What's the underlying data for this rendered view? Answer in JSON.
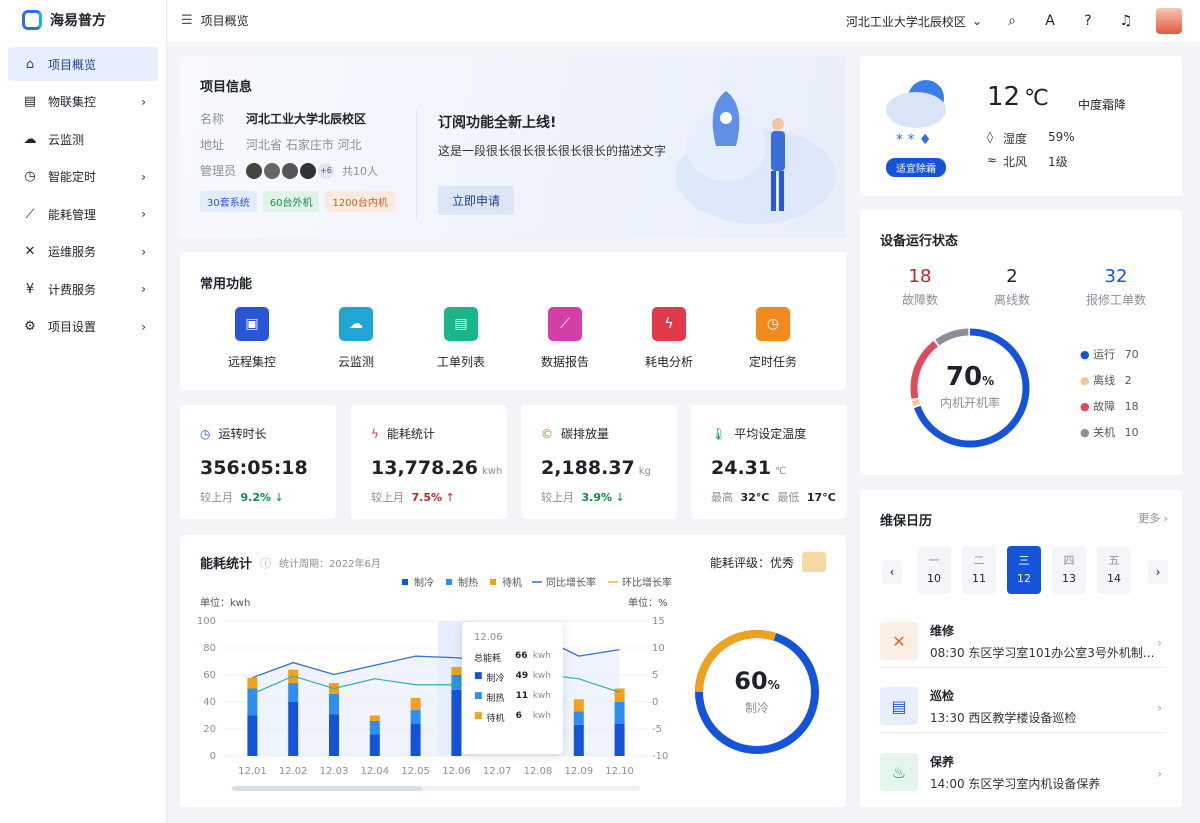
{
  "brand": "海易普方",
  "sidebar": {
    "items": [
      {
        "label": "项目概览",
        "icon": "home-icon",
        "active": true,
        "has_children": false
      },
      {
        "label": "物联集控",
        "icon": "iot-icon",
        "active": false,
        "has_children": true
      },
      {
        "label": "云监测",
        "icon": "cloud-icon",
        "active": false,
        "has_children": false
      },
      {
        "label": "智能定时",
        "icon": "clock-icon",
        "active": false,
        "has_children": true
      },
      {
        "label": "能耗管理",
        "icon": "chart-icon",
        "active": false,
        "has_children": true
      },
      {
        "label": "运维服务",
        "icon": "tools-icon",
        "active": false,
        "has_children": true
      },
      {
        "label": "计费服务",
        "icon": "billing-icon",
        "active": false,
        "has_children": true
      },
      {
        "label": "项目设置",
        "icon": "gear-icon",
        "active": false,
        "has_children": true
      }
    ]
  },
  "header": {
    "breadcrumb": "项目概览",
    "campus": "河北工业大学北辰校区"
  },
  "project": {
    "title": "项目信息",
    "name_label": "名称",
    "name": "河北工业大学北辰校区",
    "addr_label": "地址",
    "addr": "河北省 石家庄市 河北",
    "admin_label": "管理员",
    "admin_more": "+6",
    "admin_total": "共10人",
    "tags": [
      "30套系统",
      "60台外机",
      "1200台内机"
    ],
    "promo_title": "订阅功能全新上线!",
    "promo_desc": "这是一段很长很长很长很长很长的描述文字",
    "promo_btn": "立即申请"
  },
  "functions": {
    "title": "常用功能",
    "items": [
      {
        "label": "远程集控",
        "color": "#2857d6"
      },
      {
        "label": "云监测",
        "color": "#20a5d6"
      },
      {
        "label": "工单列表",
        "color": "#1bb58a"
      },
      {
        "label": "数据报告",
        "color": "#d33fa6"
      },
      {
        "label": "耗电分析",
        "color": "#e03a4a"
      },
      {
        "label": "定时任务",
        "color": "#f08a1c"
      }
    ]
  },
  "stats": [
    {
      "label": "运转时长",
      "value": "356:05:18",
      "unit": "",
      "cmp_label": "较上月",
      "cmp": "9.2%",
      "dir": "↓",
      "color": "#0c8a4a"
    },
    {
      "label": "能耗统计",
      "value": "13,778.26",
      "unit": "kwh",
      "cmp_label": "较上月",
      "cmp": "7.5%",
      "dir": "↑",
      "color": "#c8202a"
    },
    {
      "label": "碳排放量",
      "value": "2,188.37",
      "unit": "kg",
      "cmp_label": "较上月",
      "cmp": "3.9%",
      "dir": "↓",
      "color": "#0c8a4a"
    },
    {
      "label": "平均设定温度",
      "value": "24.31",
      "unit": "℃",
      "max_label": "最高",
      "max": "32°C",
      "min_label": "最低",
      "min": "17°C"
    }
  ],
  "energy": {
    "title": "能耗统计",
    "period": "统计周期：2022年6月",
    "rating": "能耗评级：优秀",
    "legend": [
      "制冷",
      "制热",
      "待机",
      "同比增长率",
      "环比增长率"
    ],
    "unit_left": "单位：kwh",
    "unit_right": "单位：%",
    "tooltip": {
      "date": "12.06",
      "total_label": "总能耗",
      "total": "66",
      "unit": "kwh",
      "rows": [
        {
          "label": "制冷",
          "value": "49"
        },
        {
          "label": "制热",
          "value": "11"
        },
        {
          "label": "待机",
          "value": "6"
        }
      ]
    },
    "donut_value": "60",
    "donut_pct": "%",
    "donut_label": "制冷",
    "colors": {
      "cool": "#1554d9",
      "heat": "#2f8ff0",
      "standby": "#f0a21c",
      "yoy": "#2f6fd6",
      "mom": "#f0b63c"
    }
  },
  "chart_data": {
    "type": "bar",
    "categories": [
      "12.01",
      "12.02",
      "12.03",
      "12.04",
      "12.05",
      "12.06",
      "12.07",
      "12.08",
      "12.09",
      "12.10"
    ],
    "series": [
      {
        "name": "制冷",
        "values": [
          30,
          40,
          31,
          16,
          24,
          49,
          0,
          0,
          23,
          24
        ]
      },
      {
        "name": "制热",
        "values": [
          20,
          14,
          15,
          10,
          10,
          11,
          0,
          0,
          10,
          16
        ]
      },
      {
        "name": "待机",
        "values": [
          8,
          10,
          8,
          4,
          9,
          6,
          0,
          0,
          9,
          10
        ]
      },
      {
        "name": "同比增长率",
        "values": [
          4.5,
          7.3,
          5.1,
          6.8,
          8.5,
          8.2,
          7.6,
          12.2,
          8.5,
          9.7
        ]
      },
      {
        "name": "环比增长率",
        "values": [
          1.5,
          4.8,
          2.5,
          4.3,
          3.2,
          3.2,
          3.3,
          5.2,
          4.3,
          1.8
        ]
      }
    ],
    "ylim": [
      0,
      100
    ],
    "y2lim": [
      -10,
      15
    ],
    "yticks": [
      0,
      20,
      40,
      60,
      80,
      100
    ],
    "y2ticks": [
      -10,
      -5,
      0,
      5,
      10,
      15
    ]
  },
  "weather": {
    "temp": "12",
    "unit": "℃",
    "condition": "中度霜降",
    "humidity_label": "湿度",
    "humidity": "59%",
    "wind_label": "北风",
    "wind": "1级",
    "badge": "适宜除霜"
  },
  "device": {
    "title": "设备运行状态",
    "fault": "18",
    "fault_label": "故障数",
    "offline": "2",
    "offline_label": "离线数",
    "repair": "32",
    "repair_label": "报修工单数",
    "rate": "70",
    "rate_pct": "%",
    "rate_label": "内机开机率",
    "legend": [
      {
        "label": "运行",
        "value": "70",
        "color": "#1554d9"
      },
      {
        "label": "离线",
        "value": "2",
        "color": "#f3c79e"
      },
      {
        "label": "故障",
        "value": "18",
        "color": "#e04a5a"
      },
      {
        "label": "关机",
        "value": "10",
        "color": "#8a8f99"
      }
    ]
  },
  "calendar": {
    "title": "维保日历",
    "more": "更多",
    "days": [
      {
        "w": "一",
        "d": "10",
        "selected": false
      },
      {
        "w": "二",
        "d": "11",
        "selected": false
      },
      {
        "w": "三",
        "d": "12",
        "selected": true
      },
      {
        "w": "四",
        "d": "13",
        "selected": false
      },
      {
        "w": "五",
        "d": "14",
        "selected": false
      }
    ],
    "items": [
      {
        "title": "维修",
        "desc": "08:30 东区学习室101办公室3号外机制...",
        "color": "#fbefe6",
        "icon_color": "#e0682a"
      },
      {
        "title": "巡检",
        "desc": "13:30 西区教学楼设备巡检",
        "color": "#e8eefb",
        "icon_color": "#2857d6"
      },
      {
        "title": "保养",
        "desc": "14:00 东区学习室内机设备保养",
        "color": "#e4f5ec",
        "icon_color": "#1b9a5a"
      }
    ]
  }
}
